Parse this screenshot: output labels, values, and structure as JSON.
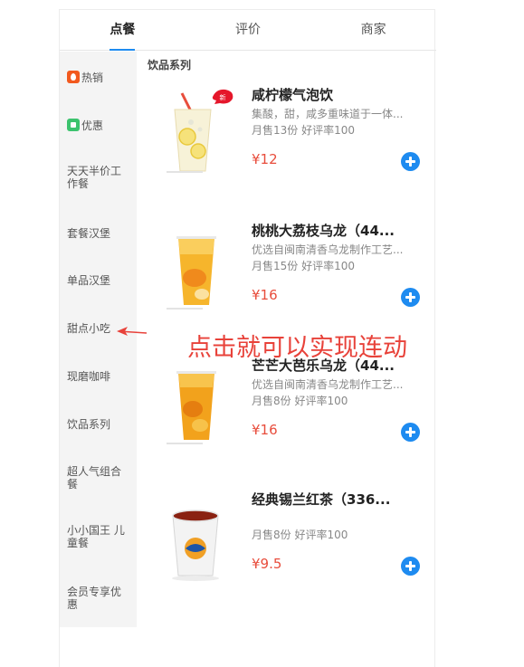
{
  "tabs": [
    "点餐",
    "评价",
    "商家"
  ],
  "active_tab": 0,
  "sidebar": {
    "items": [
      {
        "label": "热销",
        "icon": "hot-icon"
      },
      {
        "label": "优惠",
        "icon": "discount-icon"
      },
      {
        "label": "天天半价工作餐"
      },
      {
        "label": "套餐汉堡"
      },
      {
        "label": "单品汉堡"
      },
      {
        "label": "甜点小吃"
      },
      {
        "label": "现磨咖啡"
      },
      {
        "label": "饮品系列"
      },
      {
        "label": "超人气组合餐"
      },
      {
        "label": "小小国王 儿童餐"
      },
      {
        "label": "会员专享优惠"
      }
    ]
  },
  "section_title": "饮品系列",
  "products": [
    {
      "name": "咸柠檬气泡饮",
      "desc": "集酸，甜，咸多重味道于一体...",
      "sales": "月售13份 好评率100",
      "price": "¥12",
      "badge": "新"
    },
    {
      "name": "桃桃大荔枝乌龙（44...",
      "desc": "优选自闽南清香乌龙制作工艺...",
      "sales": "月售15份 好评率100",
      "price": "¥16"
    },
    {
      "name": "芒芒大芭乐乌龙（44...",
      "desc": "优选自闽南清香乌龙制作工艺...",
      "sales": "月售8份 好评率100",
      "price": "¥16"
    },
    {
      "name": "经典锡兰红茶（336...",
      "desc": "",
      "sales": "月售8份 好评率100",
      "price": "¥9.5"
    }
  ],
  "annotation": "点击就可以实现连动",
  "colors": {
    "accent": "#1e8bf0",
    "price": "#e84d3c",
    "annotation": "#e8423a",
    "hot": "#f2591e",
    "sale": "#3cc36e"
  }
}
